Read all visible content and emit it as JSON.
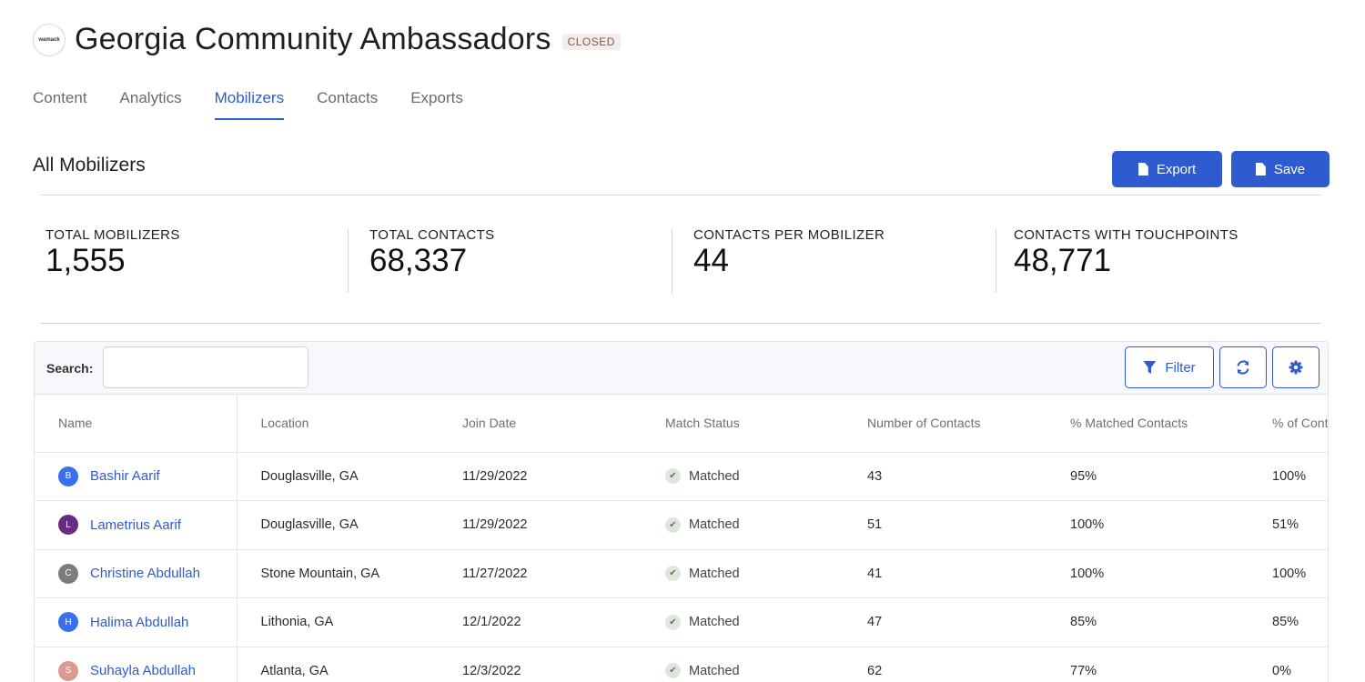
{
  "header": {
    "logo_text": "wamack",
    "title": "Georgia Community Ambassadors",
    "status_badge": "CLOSED"
  },
  "tabs": [
    {
      "label": "Content"
    },
    {
      "label": "Analytics"
    },
    {
      "label": "Mobilizers",
      "active": true
    },
    {
      "label": "Contacts"
    },
    {
      "label": "Exports"
    }
  ],
  "section": {
    "title": "All Mobilizers",
    "export_label": "Export",
    "save_label": "Save"
  },
  "stats": [
    {
      "label": "TOTAL MOBILIZERS",
      "value": "1,555"
    },
    {
      "label": "TOTAL CONTACTS",
      "value": "68,337"
    },
    {
      "label": "CONTACTS PER MOBILIZER",
      "value": "44"
    },
    {
      "label": "CONTACTS WITH TOUCHPOINTS",
      "value": "48,771"
    }
  ],
  "toolbar": {
    "search_label": "Search:",
    "search_value": "",
    "filter_label": "Filter",
    "refresh_icon": "refresh-icon",
    "settings_icon": "gear-icon"
  },
  "table": {
    "columns": [
      "Name",
      "Location",
      "Join Date",
      "Match Status",
      "Number of Contacts",
      "% Matched Contacts",
      "% of Contacts Questioned"
    ],
    "rows": [
      {
        "initial": "B",
        "avatar_color": "#3b6ff0",
        "name": "Bashir Aarif",
        "location": "Douglasville, GA",
        "join_date": "11/29/2022",
        "match_status": "Matched",
        "contacts": "43",
        "matched_pct": "95%",
        "questioned_pct": "100%"
      },
      {
        "initial": "L",
        "avatar_color": "#6a2c7e",
        "name": "Lametrius Aarif",
        "location": "Douglasville, GA",
        "join_date": "11/29/2022",
        "match_status": "Matched",
        "contacts": "51",
        "matched_pct": "100%",
        "questioned_pct": "51%"
      },
      {
        "initial": "C",
        "avatar_color": "#7c7c7c",
        "name": "Christine Abdullah",
        "location": "Stone Mountain, GA",
        "join_date": "11/27/2022",
        "match_status": "Matched",
        "contacts": "41",
        "matched_pct": "100%",
        "questioned_pct": "100%"
      },
      {
        "initial": "H",
        "avatar_color": "#3b6ff0",
        "name": "Halima Abdullah",
        "location": "Lithonia, GA",
        "join_date": "12/1/2022",
        "match_status": "Matched",
        "contacts": "47",
        "matched_pct": "85%",
        "questioned_pct": "85%"
      },
      {
        "initial": "S",
        "avatar_color": "#d99a8f",
        "name": "Suhayla Abdullah",
        "location": "Atlanta, GA",
        "join_date": "12/3/2022",
        "match_status": "Matched",
        "contacts": "62",
        "matched_pct": "77%",
        "questioned_pct": "0%"
      }
    ]
  }
}
